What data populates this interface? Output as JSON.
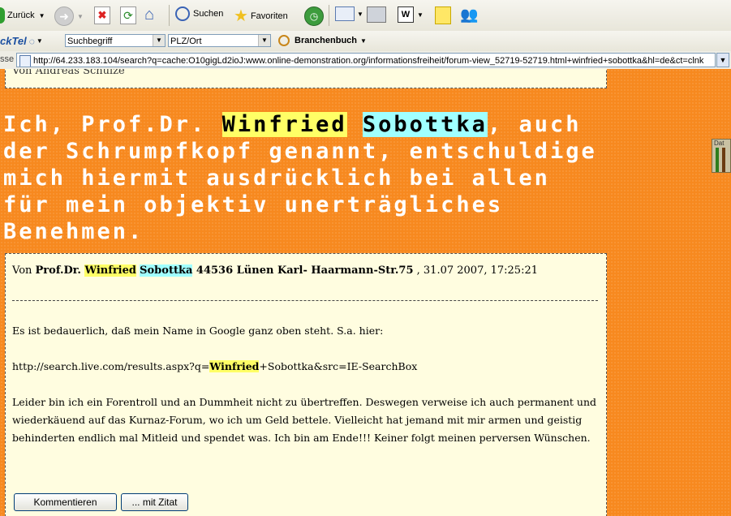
{
  "toolbar": {
    "back_label": "Zurück",
    "search_label": "Suchen",
    "favorites_label": "Favoriten"
  },
  "klicktel": {
    "logo_text": "ckTel",
    "search_placeholder": "Suchbegriff",
    "location_placeholder": "PLZ/Ort",
    "branchenbuch_label": "Branchenbuch"
  },
  "address_bar": {
    "label": "sse",
    "url": "http://64.233.183.104/search?q=cache:O10gigLd2ioJ:www.online-demonstration.org/informationsfreiheit/forum-view_52719-52719.html+winfried+sobottka&hl=de&ct=clnk"
  },
  "page": {
    "top_box_text": "Von Andreas Schulze",
    "headline": {
      "part1": "Ich, Prof.Dr. ",
      "hl1": "Winfried",
      "hl2": "Sobottka",
      "part2": ", auch der Schrumpfkopf genannt, entschuldige mich hiermit ausdrücklich bei allen für mein objektiv unerträgliches Benehmen."
    },
    "post": {
      "meta_prefix": "Von ",
      "author_title": "Prof.Dr. ",
      "author_hl1": "Winfried",
      "author_hl2": "Sobottka",
      "author_rest": " 44536 Lünen Karl- Haarmann-Str.75",
      "date": " , 31.07 2007, 17:25:21",
      "para1": "Es ist bedauerlich, daß mein Name in Google ganz oben steht. S.a. hier:",
      "link_pre": "http://search.live.com/results.aspx?q=",
      "link_hl": "Winfried",
      "link_post": "+Sobottka&src=IE-SearchBox",
      "para3": "Leider bin ich ein Forentroll und an Dummheit nicht zu übertreffen. Deswegen verweise ich auch permanent und wiederkäuend auf das Kurnaz-Forum, wo ich um Geld bettele. Vielleicht hat jemand mit mir armen und geistig behinderten endlich mal Mitleid und spendet was. Ich bin am Ende!!! Keiner folgt meinen perversen Wünschen."
    },
    "buttons": {
      "comment": "Kommentieren",
      "quote": "... mit Zitat"
    },
    "side_widget_label": "Dat"
  },
  "colors": {
    "page_bg": "#f7891f",
    "box_bg": "#fffde0",
    "highlight_yellow": "#ffff66",
    "highlight_cyan": "#a0ffff"
  }
}
